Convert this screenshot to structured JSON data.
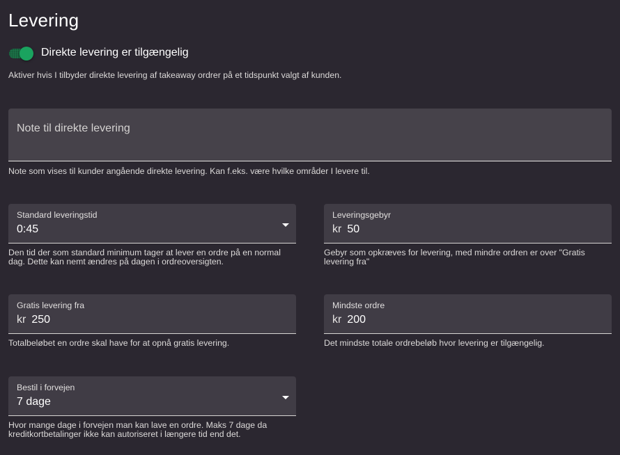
{
  "title": "Levering",
  "direct_delivery": {
    "toggle_label": "Direkte levering er tilgængelig",
    "enabled": true,
    "description": "Aktiver hvis I tilbyder direkte levering af takeaway ordrer på et tidspunkt valgt af kunden."
  },
  "note": {
    "placeholder": "Note til direkte levering",
    "value": "",
    "help": "Note som vises til kunder angående direkte levering. Kan f.eks. være hvilke områder I levere til."
  },
  "standard_time": {
    "label": "Standard leveringstid",
    "value": "0:45",
    "help": "Den tid der som standard minimum tager at lever en ordre på en normal dag. Dette kan nemt ændres på dagen i ordreoversigten."
  },
  "delivery_fee": {
    "label": "Leveringsgebyr",
    "prefix": "kr",
    "value": "50",
    "help": "Gebyr som opkræves for levering, med mindre ordren er over \"Gratis levering fra\""
  },
  "free_from": {
    "label": "Gratis levering fra",
    "prefix": "kr",
    "value": "250",
    "help": "Totalbeløbet en ordre skal have for at opnå gratis levering."
  },
  "min_order": {
    "label": "Mindste ordre",
    "prefix": "kr",
    "value": "200",
    "help": "Det mindste totale ordrebeløb hvor levering er tilgængelig."
  },
  "order_ahead": {
    "label": "Bestil i forvejen",
    "value": "7 dage",
    "help": "Hvor mange dage i forvejen man kan lave en ordre. Maks 7 dage da kreditkortbetalinger ikke kan autoriseret i længere tid end det."
  },
  "colors": {
    "background": "#2b2730",
    "field": "#403c45",
    "accent": "#1aa35f"
  }
}
